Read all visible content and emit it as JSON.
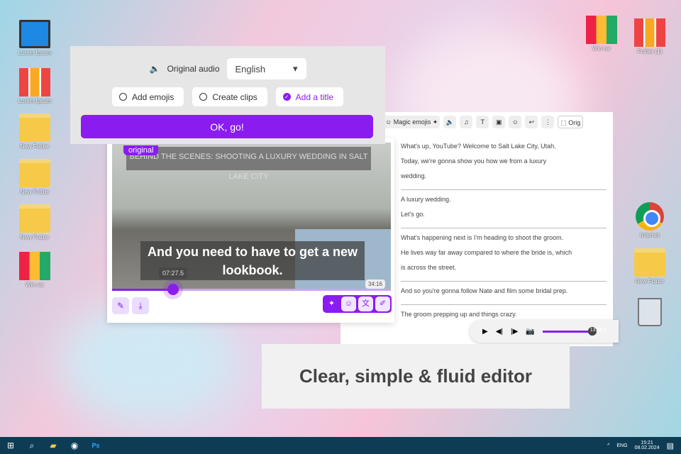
{
  "desktop": {
    "left_icons": [
      {
        "label": "Lorem Ipsum",
        "type": "computer"
      },
      {
        "label": "Lorem Ipsum",
        "type": "binders"
      },
      {
        "label": "New Folder",
        "type": "folder"
      },
      {
        "label": "New Folder",
        "type": "folder"
      },
      {
        "label": "New Folder",
        "type": "folder"
      },
      {
        "label": "Win-rar",
        "type": "winrar"
      }
    ],
    "right_icons": [
      {
        "label": "Win-rar",
        "type": "winrar"
      },
      {
        "label": "Folder (1)",
        "type": "binders"
      },
      {
        "label": "Internet",
        "type": "chrome"
      },
      {
        "label": "New Folder",
        "type": "folder"
      },
      {
        "label": "",
        "type": "recycle-bin"
      }
    ]
  },
  "dialog": {
    "audio_label": "Original audio",
    "language": "English",
    "options": [
      {
        "label": "Add emojis",
        "checked": false
      },
      {
        "label": "Create clips",
        "checked": false
      },
      {
        "label": "Add a title",
        "checked": true
      }
    ],
    "ok_label": "OK, go!"
  },
  "video": {
    "badge": "original",
    "title": "BEHIND THE SCENES: SHOOTING A LUXURY WEDDING IN SALT LAKE CITY",
    "caption": "And you need to have to get a new lookbook.",
    "current_time": "07:27.5",
    "duration": "34:16",
    "progress": 0.22
  },
  "transcript": {
    "toolbar": {
      "magic_emojis": "Magic emojis",
      "original": "Orig"
    },
    "lines": [
      "What's up, YouTube? Welcome to Salt Lake City, Utah.",
      "Today, we're gonna show you how we from a luxury",
      "wedding.",
      "A luxury wedding.",
      "Let's go.",
      "What's happening next is I'm heading to shoot the groom.",
      "He lives way far away compared to where the bride is, which",
      "is across the street.",
      "And so you're gonna follow Nate and film some bridal prep.",
      "The groom prepping up and things crazy."
    ],
    "player_time": "13:58.9"
  },
  "caption": "Clear, simple & fluid editor",
  "taskbar": {
    "lang": "ENG",
    "time": "15:21",
    "date": "08.02.2024"
  },
  "accent": "#8a1cf0"
}
